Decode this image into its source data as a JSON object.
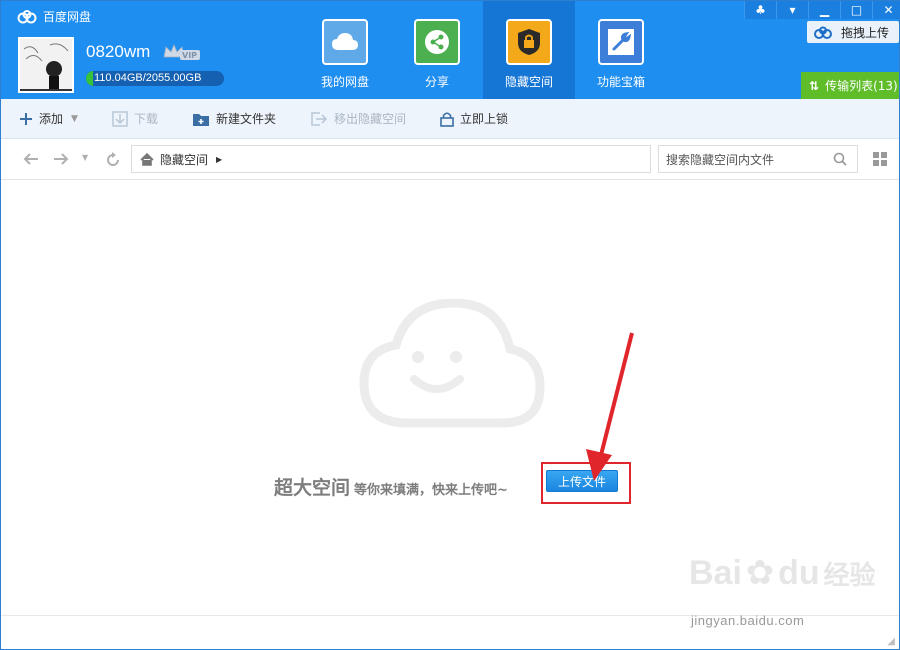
{
  "app": {
    "title": "百度网盘"
  },
  "user": {
    "name": "0820wm",
    "quota_text": "110.04GB/2055.00GB",
    "quota_used_fraction": 0.054,
    "vip_badge": "VIP"
  },
  "nav": [
    {
      "label": "我的网盘",
      "icon": "cloud-icon",
      "color": "#5fa9e8"
    },
    {
      "label": "分享",
      "icon": "share-icon",
      "color": "#4cb050"
    },
    {
      "label": "隐藏空间",
      "icon": "lock-icon",
      "color": "#f3a91a"
    },
    {
      "label": "功能宝箱",
      "icon": "wrench-icon",
      "color": "#3d7fd8"
    }
  ],
  "header_right": {
    "drag_upload": "拖拽上传",
    "transfer_list": "传输列表(13)"
  },
  "toolbar": {
    "add": "添加",
    "download": "下载",
    "new_folder": "新建文件夹",
    "move_out": "移出隐藏空间",
    "lock_now": "立即上锁"
  },
  "address": {
    "breadcrumb": "隐藏空间",
    "search_placeholder": "搜索隐藏空间内文件"
  },
  "empty_state": {
    "headline": "超大空间",
    "subline": "等你来填满，快来上传吧~",
    "upload_button": "上传文件"
  },
  "watermark": {
    "brand": "Bai",
    "brand2": "du",
    "suffix": "经验",
    "domain": "jingyan.baidu.com"
  },
  "colors": {
    "header": "#1e8ef0",
    "accent_green": "#5fbd2a",
    "highlight_red": "#e0252b"
  }
}
